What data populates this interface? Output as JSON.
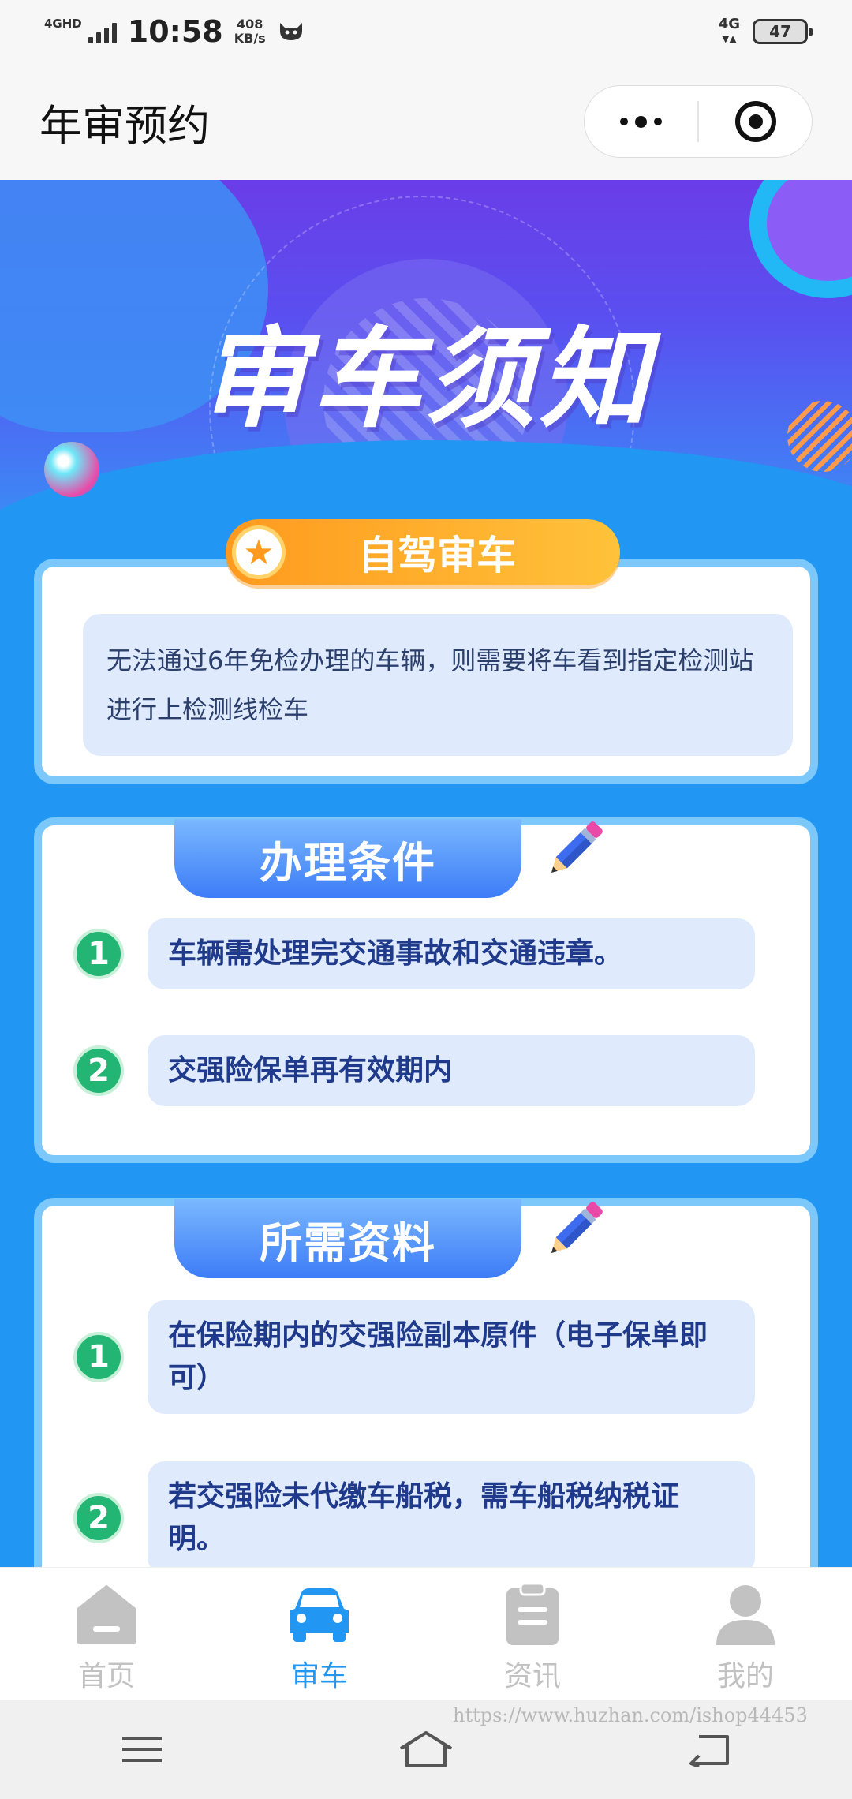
{
  "status_bar": {
    "network_badge": "4GHD",
    "time": "10:58",
    "speed_value": "408",
    "speed_unit": "KB/s",
    "cell_label": "4G",
    "battery": "47"
  },
  "title_bar": {
    "title": "年审预约"
  },
  "banner": {
    "heading": "审车须知"
  },
  "self_drive": {
    "tag": "自驾审车",
    "text": "无法通过6年免检办理的车辆，则需要将车看到指定检测站进行上检测线检车"
  },
  "conditions": {
    "tag": "办理条件",
    "items": [
      {
        "num": "1",
        "text": "车辆需处理完交通事故和交通违章。"
      },
      {
        "num": "2",
        "text": "交强险保单再有效期内"
      }
    ]
  },
  "documents": {
    "tag": "所需资料",
    "items": [
      {
        "num": "1",
        "text": "在保险期内的交强险副本原件（电子保单即可）"
      },
      {
        "num": "2",
        "text": "若交强险未代缴车船税，需车船税纳税证明。"
      }
    ]
  },
  "tab_bar": {
    "active_color": "#2196f3",
    "inactive_color": "#c2c2c2",
    "tabs": [
      {
        "label": "首页",
        "icon": "home-icon"
      },
      {
        "label": "审车",
        "icon": "car-icon"
      },
      {
        "label": "资讯",
        "icon": "clipboard-icon"
      },
      {
        "label": "我的",
        "icon": "user-icon"
      }
    ]
  },
  "watermark": "https://www.huzhan.com/ishop44453"
}
